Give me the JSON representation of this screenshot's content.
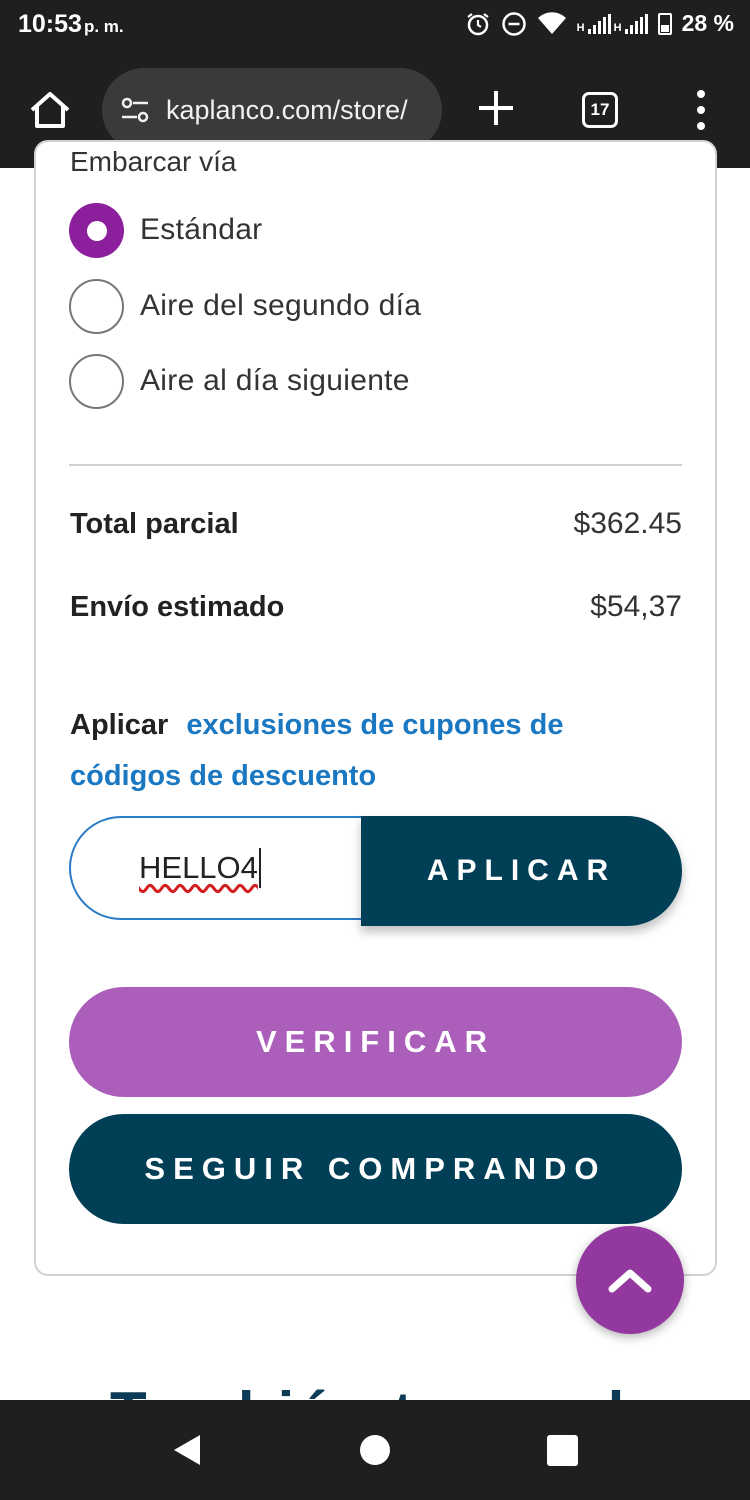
{
  "status_bar": {
    "time": "10:53",
    "ampm": "p. m.",
    "battery": "28 %",
    "network_label": "H",
    "icons": [
      "alarm-icon",
      "dnd-icon",
      "wifi-icon",
      "signal-icon",
      "battery-icon"
    ]
  },
  "browser": {
    "url": "kaplanco.com/store/",
    "tab_count": "17",
    "icons": [
      "home-icon",
      "site-settings-icon",
      "new-tab-icon",
      "tabs-icon",
      "more-menu-icon"
    ]
  },
  "shipping": {
    "label": "Embarcar vía",
    "options": [
      {
        "label": "Estándar",
        "selected": true
      },
      {
        "label": "Aire del segundo día",
        "selected": false
      },
      {
        "label": "Aire al día siguiente",
        "selected": false
      }
    ]
  },
  "summary": {
    "subtotal_label": "Total parcial",
    "subtotal_value": "$362.45",
    "shipping_label": "Envío estimado",
    "shipping_value": "$54,37"
  },
  "coupon": {
    "apply_word": "Aplicar",
    "link_text": "exclusiones de cupones de códigos de descuento",
    "input_value": "HELLO4",
    "apply_button": "APLICAR"
  },
  "actions": {
    "verify_button": "VERIFICAR",
    "continue_button": "SEGUIR COMPRANDO"
  },
  "below_fold_heading": "También te puede",
  "colors": {
    "purple": "#8c1f9b",
    "light_purple": "#ab5fbb",
    "navy": "#003f56",
    "link_blue": "#1a78c2"
  }
}
